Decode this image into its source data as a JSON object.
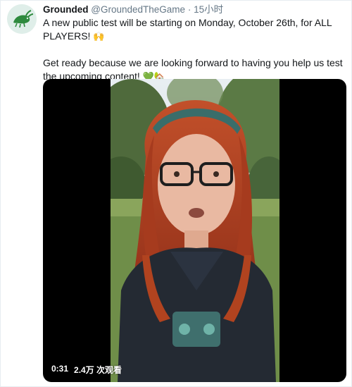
{
  "tweet": {
    "display_name": "Grounded",
    "handle": "@GroundedTheGame",
    "separator": "·",
    "time": "15小时",
    "text_para1": "A new public test will be starting on Monday, October 26th, for ALL PLAYERS!",
    "text_para1_emoji": "🙌",
    "text_para2": "Get ready because we are looking forward to having you help us test the upcoming content!",
    "text_para2_emoji_1": "💚",
    "text_para2_emoji_2": "🏡"
  },
  "video": {
    "duration": "0:31",
    "views": "2.4万 次观看"
  },
  "colors": {
    "avatar_bg": "#dfeee9",
    "avatar_logo": "#2e8a3e",
    "secondary_text": "#657786",
    "video_bg": "#000000"
  },
  "icons": {
    "avatar": "grounded-ant-logo-icon"
  }
}
